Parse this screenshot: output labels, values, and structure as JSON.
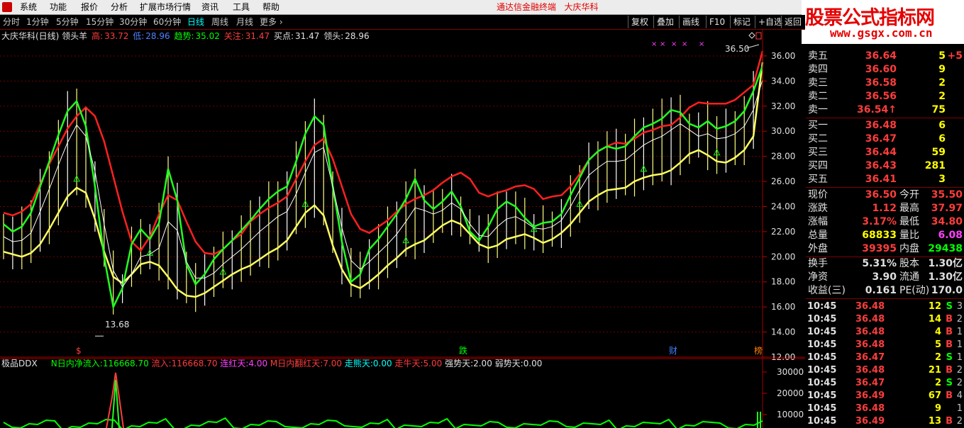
{
  "menu": {
    "items": [
      "系统",
      "功能",
      "报价",
      "分析",
      "扩展市场行情",
      "资讯",
      "工具",
      "帮助"
    ],
    "title": "通达信金融终端   大庆华科"
  },
  "brand": {
    "name": "股票公式指标网",
    "url": "www.gsgx.com.cn"
  },
  "periods": [
    "分时",
    "1分钟",
    "5分钟",
    "15分钟",
    "30分钟",
    "60分钟",
    "日线",
    "周线",
    "月线",
    "更多 ›"
  ],
  "active_period": "日线",
  "tools": [
    "复权",
    "叠加",
    "画线",
    "F10",
    "标记",
    "+自选",
    "返回"
  ],
  "info": {
    "stock": "大庆华科(日线) 领头羊",
    "high_label": "高:",
    "high": "33.72",
    "low_label": "低:",
    "low": "28.96",
    "trend_label": "趋势:",
    "trend": "35.02",
    "focus_label": "关注:",
    "focus": "31.47",
    "buy_label": "买点:",
    "buy": "31.47",
    "lead_label": "领头:",
    "lead": "28.96"
  },
  "price_axis": {
    "ticks": [
      "36.00",
      "34.00",
      "32.00",
      "30.00",
      "28.00",
      "26.00",
      "24.00",
      "22.00",
      "20.00",
      "18.00",
      "16.00",
      "14.00",
      "12.00"
    ],
    "max_label": "36.50",
    "min_label": "13.68"
  },
  "markers": {
    "m1": "$",
    "m2": "跌",
    "m3": "财",
    "m4": "榜"
  },
  "ddx": {
    "name": "极品DDX",
    "n_label": "N日内净流入:",
    "n_val": "116668.70",
    "in_label": "流入:",
    "in_val": "116668.70",
    "lian_label": "连红天:",
    "lian_val": "4.00",
    "m_label": "M日内翻红天:",
    "m_val": "7.00",
    "zn_label": "走熊天:",
    "zn_val": "0.00",
    "zniu_label": "走牛天:",
    "zniu_val": "5.00",
    "qs_label": "强势天:",
    "qs_val": "2.00",
    "rs_label": "弱势天:",
    "rs_val": "0.00",
    "ticks": [
      "30000",
      "20000",
      "10000"
    ]
  },
  "asks": [
    {
      "label": "卖五",
      "price": "36.64",
      "vol": "5",
      "flag": ""
    },
    {
      "label": "卖四",
      "price": "36.60",
      "vol": "9",
      "flag": ""
    },
    {
      "label": "卖三",
      "price": "36.58",
      "vol": "2",
      "flag": ""
    },
    {
      "label": "卖二",
      "price": "36.56",
      "vol": "2",
      "flag": ""
    },
    {
      "label": "卖一",
      "price": "36.54",
      "vol": "75",
      "flag": "↑"
    }
  ],
  "bids": [
    {
      "label": "买一",
      "price": "36.48",
      "vol": "6"
    },
    {
      "label": "买二",
      "price": "36.47",
      "vol": "6"
    },
    {
      "label": "买三",
      "price": "36.44",
      "vol": "59"
    },
    {
      "label": "买四",
      "price": "36.43",
      "vol": "281"
    },
    {
      "label": "买五",
      "price": "36.41",
      "vol": "3"
    }
  ],
  "ask_extra": "+5",
  "stats": [
    {
      "l": "现价",
      "v": "36.50",
      "l2": "今开",
      "v2": "35.50",
      "c1": "#ff3c3c",
      "c2": "#ff3c3c"
    },
    {
      "l": "涨跌",
      "v": "1.12",
      "l2": "最高",
      "v2": "37.97",
      "c1": "#ff3c3c",
      "c2": "#ff3c3c"
    },
    {
      "l": "涨幅",
      "v": "3.17%",
      "l2": "最低",
      "v2": "34.80",
      "c1": "#ff3c3c",
      "c2": "#ff3c3c"
    },
    {
      "l": "总量",
      "v": "68833",
      "l2": "量比",
      "v2": "6.08",
      "c1": "#ffff00",
      "c2": "#ff40ff"
    },
    {
      "l": "外盘",
      "v": "39395",
      "l2": "内盘",
      "v2": "29438",
      "c1": "#ff3c3c",
      "c2": "#00ff00"
    },
    {
      "l": "换手",
      "v": "5.31%",
      "l2": "股本",
      "v2": "1.30亿",
      "c1": "#e0e0e0",
      "c2": "#e0e0e0"
    },
    {
      "l": "净资",
      "v": "3.90",
      "l2": "流通",
      "v2": "1.30亿",
      "c1": "#e0e0e0",
      "c2": "#e0e0e0"
    },
    {
      "l": "收益(三)",
      "v": "0.161",
      "l2": "PE(动)",
      "v2": "170.0",
      "c1": "#e0e0e0",
      "c2": "#e0e0e0"
    }
  ],
  "ticks": [
    {
      "t": "10:45",
      "p": "36.48",
      "v": "12",
      "s": "S",
      "n": "3"
    },
    {
      "t": "10:45",
      "p": "36.48",
      "v": "14",
      "s": "B",
      "n": "2"
    },
    {
      "t": "10:45",
      "p": "36.48",
      "v": "4",
      "s": "B",
      "n": "1"
    },
    {
      "t": "10:45",
      "p": "36.48",
      "v": "5",
      "s": "B",
      "n": "1"
    },
    {
      "t": "10:45",
      "p": "36.47",
      "v": "2",
      "s": "S",
      "n": "1"
    },
    {
      "t": "10:45",
      "p": "36.48",
      "v": "21",
      "s": "B",
      "n": "2"
    },
    {
      "t": "10:45",
      "p": "36.47",
      "v": "2",
      "s": "S",
      "n": "2"
    },
    {
      "t": "10:45",
      "p": "36.49",
      "v": "67",
      "s": "B",
      "n": "4"
    },
    {
      "t": "10:45",
      "p": "36.48",
      "v": "9",
      "s": "",
      "n": "1"
    },
    {
      "t": "10:45",
      "p": "36.49",
      "v": "13",
      "s": "B",
      "n": "2"
    }
  ],
  "colors": {
    "red": "#ff3c3c",
    "green": "#00ff00",
    "yellow": "#ffff00",
    "cyan": "#00ffff",
    "magenta": "#ff40ff",
    "grid": "#800000"
  },
  "chart_data": {
    "type": "line",
    "y_range": [
      12,
      36.9
    ],
    "series": [
      {
        "color": "#ff2020",
        "values": [
          23.5,
          23.3,
          23.6,
          24.2,
          25.8,
          27.4,
          28.8,
          30.2,
          31.2,
          31.9,
          31.2,
          29.2,
          26.4,
          23.6,
          21.2,
          20.5,
          21.6,
          23.4,
          24.9,
          24.5,
          22.8,
          21.2,
          20.3,
          20.2,
          20.6,
          21.3,
          21.8,
          22.8,
          23.4,
          23.9,
          24.3,
          24.8,
          26.2,
          27.6,
          28.9,
          29.4,
          27.8,
          25.6,
          23.4,
          22.2,
          21.9,
          22.4,
          22.9,
          23.6,
          24.2,
          24.6,
          24.9,
          25.3,
          25.9,
          26.4,
          26.7,
          26.2,
          25.1,
          24.8,
          25.1,
          25.3,
          25.6,
          25.7,
          25.4,
          24.6,
          24.8,
          24.9,
          25.6,
          26.6,
          27.7,
          28.4,
          28.8,
          29.1,
          29.0,
          29.4,
          29.9,
          30.1,
          30.4,
          30.5,
          31.1,
          31.9,
          32.3,
          32.2,
          32.2,
          32.2,
          32.5,
          33.1,
          33.7,
          36.4
        ]
      },
      {
        "color": "#ffff60",
        "values": [
          20.4,
          20.2,
          20.0,
          20.3,
          21.0,
          22.2,
          23.5,
          24.8,
          25.5,
          25.1,
          23.0,
          20.4,
          18.4,
          17.9,
          18.6,
          19.4,
          19.6,
          19.3,
          18.4,
          17.4,
          16.9,
          16.8,
          17.1,
          17.6,
          18.1,
          18.6,
          19.0,
          19.3,
          19.8,
          20.3,
          20.7,
          21.3,
          22.4,
          23.5,
          24.1,
          23.3,
          20.9,
          19.0,
          17.8,
          17.5,
          18.0,
          18.6,
          19.3,
          19.9,
          20.6,
          21.0,
          21.3,
          21.9,
          22.5,
          22.9,
          22.6,
          21.8,
          21.0,
          20.7,
          20.9,
          21.4,
          21.6,
          21.8,
          21.5,
          21.1,
          21.4,
          21.9,
          22.6,
          23.5,
          24.4,
          24.9,
          25.3,
          25.4,
          25.5,
          26.0,
          26.3,
          26.5,
          26.6,
          26.9,
          27.5,
          28.2,
          28.5,
          28.1,
          27.6,
          27.5,
          27.9,
          28.5,
          29.6,
          35.5
        ]
      },
      {
        "color": "#20ff20",
        "values": [
          22.6,
          22.0,
          22.4,
          23.5,
          25.6,
          27.6,
          29.7,
          31.6,
          32.4,
          30.4,
          25.6,
          20.0,
          16.0,
          17.5,
          21.0,
          22.2,
          21.4,
          22.7,
          27.0,
          24.5,
          19.4,
          17.8,
          18.6,
          19.8,
          20.6,
          21.3,
          22.1,
          22.9,
          23.8,
          24.6,
          25.2,
          25.6,
          27.6,
          29.8,
          31.2,
          30.5,
          25.6,
          21.2,
          18.0,
          18.6,
          20.6,
          21.4,
          22.4,
          23.4,
          24.6,
          26.2,
          24.5,
          23.8,
          24.4,
          25.2,
          24.0,
          22.0,
          21.3,
          22.4,
          23.8,
          24.4,
          24.0,
          23.1,
          22.4,
          22.7,
          22.8,
          23.4,
          24.9,
          26.3,
          27.7,
          28.4,
          28.8,
          28.6,
          28.8,
          29.6,
          30.3,
          30.6,
          31.0,
          31.7,
          31.5,
          30.6,
          30.3,
          30.8,
          30.2,
          30.4,
          30.8,
          31.6,
          33.2,
          35.2
        ]
      },
      {
        "color": "#ffffff",
        "values": [
          21.6,
          21.2,
          21.3,
          21.9,
          23.6,
          25.4,
          27.3,
          29.1,
          30.5,
          29.6,
          26.8,
          22.6,
          18.9,
          17.6,
          18.6,
          20.0,
          20.2,
          20.7,
          22.8,
          22.1,
          19.6,
          18.3,
          18.3,
          18.7,
          19.4,
          20.0,
          20.6,
          21.3,
          22.0,
          22.6,
          23.2,
          23.6,
          25.0,
          26.7,
          28.3,
          28.7,
          25.6,
          22.3,
          19.7,
          19.0,
          19.6,
          20.3,
          21.0,
          21.8,
          22.8,
          23.9,
          23.7,
          23.4,
          23.7,
          24.3,
          23.8,
          22.6,
          21.7,
          21.6,
          22.4,
          23.0,
          23.2,
          22.8,
          22.3,
          22.2,
          22.4,
          22.9,
          24.0,
          25.3,
          26.5,
          27.1,
          27.6,
          27.6,
          27.7,
          28.3,
          28.9,
          29.3,
          29.6,
          30.1,
          30.6,
          30.1,
          29.6,
          29.8,
          29.4,
          29.5,
          29.8,
          30.4,
          31.7,
          34.1
        ]
      }
    ]
  }
}
